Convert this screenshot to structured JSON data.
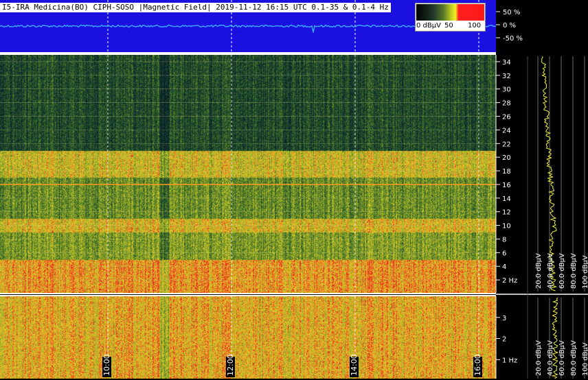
{
  "header": {
    "title": "I5-IRA Medicina(BO) CIPH-SOSO |Magnetic Field| 2019-11-12 16:15 UTC 0.1-35 & 0.1-4 Hz"
  },
  "colorbar": {
    "labels": [
      "0 dBµV",
      "50",
      "100"
    ],
    "colors": [
      "#000000",
      "#2a4a3a",
      "#6a8a2a",
      "#c8d020",
      "#f0f020",
      "#ff2020"
    ]
  },
  "chart_data": [
    {
      "type": "line",
      "title": "",
      "yticks": [
        "50 %",
        "0 %",
        "-50 %"
      ],
      "ylim": [
        -100,
        100
      ],
      "series": [
        {
          "values_note_free": [],
          "values": [
            0,
            0,
            0,
            0,
            0
          ]
        }
      ],
      "x_ticks": [
        "10:00",
        "12:00",
        "14:00",
        "16:00"
      ]
    },
    {
      "type": "heatmap",
      "yticks": [
        "34",
        "32",
        "30",
        "28",
        "26",
        "24",
        "22",
        "20",
        "18",
        "16",
        "14",
        "12",
        "10",
        "8",
        "6",
        "4",
        "2 Hz"
      ],
      "ylim": [
        0.1,
        35
      ],
      "x_ticks": [
        "10:00",
        "12:00",
        "14:00",
        "16:00"
      ],
      "bands": [
        {
          "from": 0.1,
          "to": 5,
          "level": 0.85
        },
        {
          "from": 5,
          "to": 9,
          "level": 0.55
        },
        {
          "from": 9,
          "to": 11,
          "level": 0.75
        },
        {
          "from": 11,
          "to": 17,
          "level": 0.5
        },
        {
          "from": 17,
          "to": 21,
          "level": 0.72
        },
        {
          "from": 21,
          "to": 35,
          "level": 0.25
        }
      ]
    },
    {
      "type": "heatmap",
      "yticks": [
        "3",
        "2",
        "1 Hz"
      ],
      "ylim": [
        0.1,
        4
      ],
      "x_ticks": [
        "10:00",
        "12:00",
        "14:00",
        "16:00"
      ],
      "bands": [
        {
          "from": 0.1,
          "to": 4,
          "level": 0.8
        }
      ]
    }
  ],
  "time_labels": [
    "10:00",
    "12:00",
    "14:00",
    "16:00"
  ],
  "spectrum": {
    "upper_ticks": [
      "20.0 dBµV",
      "40.0 dBµV",
      "60.0 dBµV",
      "80.0 dBµV",
      "100 dBµV"
    ],
    "lower_ticks": [
      "20.0 dBµV",
      "40.0 dBµV",
      "60.0 dBµV",
      "80.0 dBµV",
      "100 dBµV"
    ]
  }
}
